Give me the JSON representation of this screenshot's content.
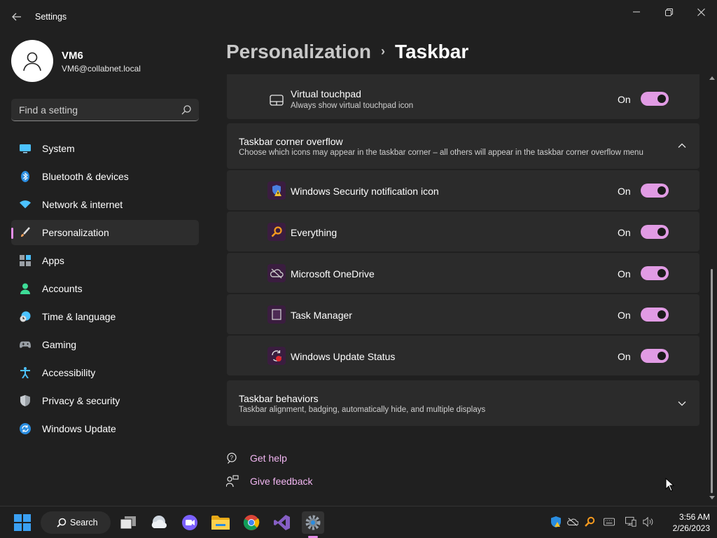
{
  "window": {
    "title": "Settings"
  },
  "profile": {
    "name": "VM6",
    "email": "VM6@collabnet.local"
  },
  "search": {
    "placeholder": "Find a setting"
  },
  "nav": {
    "items": [
      {
        "label": "System",
        "icon": "system-icon",
        "color": "#4cc2ff"
      },
      {
        "label": "Bluetooth & devices",
        "icon": "bluetooth-icon",
        "color": "#4cc2ff"
      },
      {
        "label": "Network & internet",
        "icon": "wifi-icon",
        "color": "#4cc2ff"
      },
      {
        "label": "Personalization",
        "icon": "brush-icon",
        "color": "#f7a35c",
        "active": true
      },
      {
        "label": "Apps",
        "icon": "apps-icon",
        "color": "#9aa0a6"
      },
      {
        "label": "Accounts",
        "icon": "accounts-icon",
        "color": "#3ddc97"
      },
      {
        "label": "Time & language",
        "icon": "clock-globe-icon",
        "color": "#4cc2ff"
      },
      {
        "label": "Gaming",
        "icon": "gamepad-icon",
        "color": "#9aa0a6"
      },
      {
        "label": "Accessibility",
        "icon": "accessibility-icon",
        "color": "#4cc2ff"
      },
      {
        "label": "Privacy & security",
        "icon": "shield-icon",
        "color": "#9aa0a6"
      },
      {
        "label": "Windows Update",
        "icon": "update-icon",
        "color": "#4cc2ff"
      }
    ]
  },
  "header": {
    "parent": "Personalization",
    "separator": "›",
    "current": "Taskbar"
  },
  "virtual_touchpad": {
    "title": "Virtual touchpad",
    "subtitle": "Always show virtual touchpad icon",
    "state": "On"
  },
  "corner_overflow": {
    "title": "Taskbar corner overflow",
    "subtitle": "Choose which icons may appear in the taskbar corner – all others will appear in the taskbar corner overflow menu",
    "items": [
      {
        "label": "Windows Security notification icon",
        "state": "On"
      },
      {
        "label": "Everything",
        "state": "On"
      },
      {
        "label": "Microsoft OneDrive",
        "state": "On"
      },
      {
        "label": "Task Manager",
        "state": "On"
      },
      {
        "label": "Windows Update Status",
        "state": "On"
      }
    ]
  },
  "behaviors": {
    "title": "Taskbar behaviors",
    "subtitle": "Taskbar alignment, badging, automatically hide, and multiple displays"
  },
  "help": {
    "get_help": "Get help",
    "give_feedback": "Give feedback"
  },
  "taskbar": {
    "search_label": "Search",
    "time": "3:56 AM",
    "date": "2/26/2023"
  },
  "colors": {
    "accent": "#e19be4",
    "link": "#f2b6f2",
    "card": "#2b2b2b",
    "background": "#202020"
  }
}
